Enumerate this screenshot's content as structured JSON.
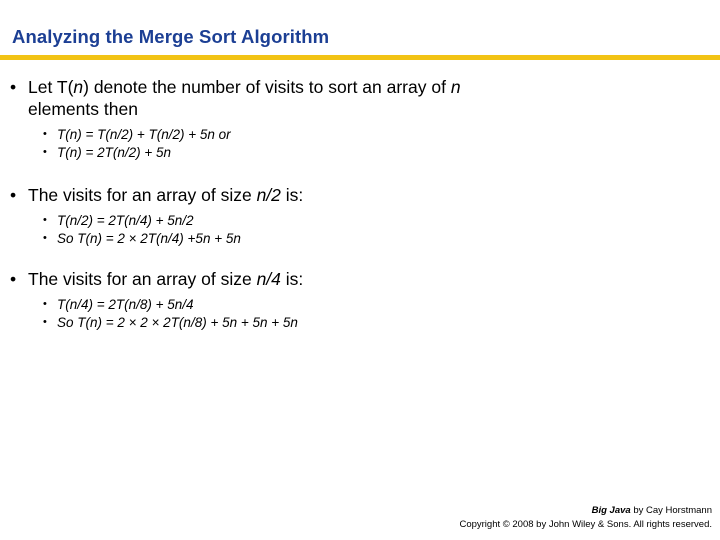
{
  "slide": {
    "title": "Analyzing the Merge Sort Algorithm",
    "accent_color": "#f2c314",
    "title_color": "#1c3f94",
    "background_color": "#ffffff",
    "bullet_glyph": "•"
  },
  "content": {
    "block1": {
      "main": {
        "part1": "Let T(",
        "var1": "n",
        "part2": ") denote the number of visits to sort an array of ",
        "var2": "n",
        "part3": "",
        "line2": "elements then",
        "full_text": "Let T(n) denote the number of visits to sort an array of n elements then"
      },
      "subs": [
        "T(n) = T(n/2) + T(n/2) + 5n or",
        "T(n) = 2T(n/2) + 5n"
      ]
    },
    "block2": {
      "main": {
        "part1": "The visits for an array of size ",
        "var1": "n/2",
        "part2": " is:",
        "full_text": "The visits for an array of size n/2 is:"
      },
      "subs": [
        "T(n/2) = 2T(n/4) + 5n/2",
        "So T(n) = 2 × 2T(n/4) +5n + 5n"
      ]
    },
    "block3": {
      "main": {
        "part1": "The visits for an array of size ",
        "var1": "n/4",
        "part2": " is:",
        "full_text": "The visits for an array of size n/4 is:"
      },
      "subs": [
        "T(n/4) = 2T(n/8) + 5n/4",
        "So T(n) = 2 × 2 × 2T(n/8) + 5n + 5n + 5n"
      ]
    }
  },
  "footer": {
    "book_title": "Big Java",
    "byline": " by Cay Horstmann",
    "copyright": "Copyright © 2008 by John Wiley & Sons.  All rights reserved."
  }
}
